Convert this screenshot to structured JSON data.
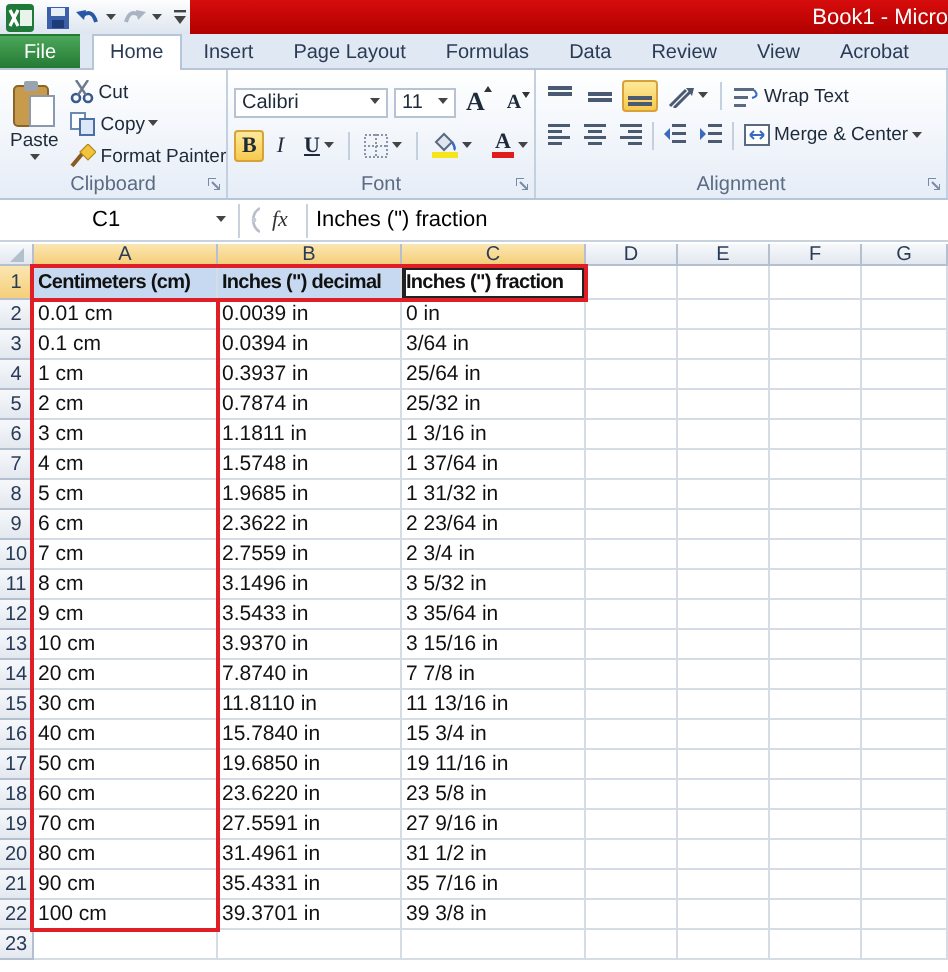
{
  "title_bar": {
    "title": "Book1 - Micro"
  },
  "tabs": [
    {
      "label": "File",
      "kind": "file",
      "selected": false
    },
    {
      "label": "Home",
      "kind": "tab",
      "selected": true
    },
    {
      "label": "Insert",
      "kind": "tab",
      "selected": false
    },
    {
      "label": "Page Layout",
      "kind": "tab",
      "selected": false
    },
    {
      "label": "Formulas",
      "kind": "tab",
      "selected": false
    },
    {
      "label": "Data",
      "kind": "tab",
      "selected": false
    },
    {
      "label": "Review",
      "kind": "tab",
      "selected": false
    },
    {
      "label": "View",
      "kind": "tab",
      "selected": false
    },
    {
      "label": "Acrobat",
      "kind": "tab",
      "selected": false
    }
  ],
  "ribbon": {
    "clipboard": {
      "label": "Clipboard",
      "paste": "Paste",
      "items": [
        {
          "kind": "cut",
          "label": "Cut"
        },
        {
          "kind": "copy",
          "label": "Copy"
        },
        {
          "kind": "painter",
          "label": "Format Painter"
        }
      ]
    },
    "font": {
      "label": "Font",
      "font_name": "Calibri",
      "font_size": "11",
      "grow": "A",
      "shrink": "A",
      "buttons": [
        {
          "kind": "bold",
          "label": "B",
          "selected": true
        },
        {
          "kind": "italic",
          "label": "I",
          "selected": false
        },
        {
          "kind": "underline",
          "label": "U",
          "selected": false
        },
        {
          "kind": "borders"
        },
        {
          "kind": "fill"
        },
        {
          "kind": "color",
          "label": "A"
        }
      ]
    },
    "alignment": {
      "label": "Alignment",
      "vertical": [
        {
          "kind": "top",
          "selected": false
        },
        {
          "kind": "middle",
          "selected": false
        },
        {
          "kind": "bottom",
          "selected": true
        }
      ],
      "horizontal": [
        {
          "kind": "left",
          "selected": false
        },
        {
          "kind": "center",
          "selected": false
        },
        {
          "kind": "right",
          "selected": false
        }
      ],
      "wrap_text": "Wrap Text",
      "merge": "Merge & Center"
    }
  },
  "formula_bar": {
    "name_box": "C1",
    "fx": "fx",
    "content": "Inches (\") fraction"
  },
  "sheet": {
    "columns": [
      {
        "label": "A",
        "selected": true,
        "framed": true
      },
      {
        "label": "B",
        "selected": true,
        "framed": false
      },
      {
        "label": "C",
        "selected": true,
        "framed": false
      },
      {
        "label": "D",
        "selected": false,
        "framed": false
      },
      {
        "label": "E",
        "selected": false,
        "framed": false
      },
      {
        "label": "F",
        "selected": false,
        "framed": false
      },
      {
        "label": "G",
        "selected": false,
        "framed": false
      }
    ],
    "rows": [
      {
        "number": "1",
        "kind": "header",
        "selected": true,
        "framed": true,
        "cells": [
          {
            "text": "Centimeters (cm)",
            "selected": true,
            "active": false
          },
          {
            "text": "Inches (\") decimal",
            "selected": true,
            "active": false
          },
          {
            "text": "Inches (\") fraction",
            "selected": true,
            "active": true
          }
        ]
      },
      {
        "number": "2",
        "kind": "data",
        "selected": false,
        "framed": false,
        "cells": [
          "0.01 cm",
          "0.0039 in",
          "0 in"
        ]
      },
      {
        "number": "3",
        "kind": "data",
        "selected": false,
        "framed": false,
        "cells": [
          "0.1 cm",
          "0.0394 in",
          "3/64 in"
        ]
      },
      {
        "number": "4",
        "kind": "data",
        "selected": false,
        "framed": false,
        "cells": [
          "1 cm",
          "0.3937 in",
          "25/64 in"
        ]
      },
      {
        "number": "5",
        "kind": "data",
        "selected": false,
        "framed": false,
        "cells": [
          "2 cm",
          "0.7874 in",
          "25/32 in"
        ]
      },
      {
        "number": "6",
        "kind": "data",
        "selected": false,
        "framed": false,
        "cells": [
          "3 cm",
          "1.1811 in",
          "1 3/16 in"
        ]
      },
      {
        "number": "7",
        "kind": "data",
        "selected": false,
        "framed": false,
        "cells": [
          "4 cm",
          "1.5748 in",
          "1 37/64 in"
        ]
      },
      {
        "number": "8",
        "kind": "data",
        "selected": false,
        "framed": false,
        "cells": [
          "5 cm",
          "1.9685 in",
          "1 31/32 in"
        ]
      },
      {
        "number": "9",
        "kind": "data",
        "selected": false,
        "framed": false,
        "cells": [
          "6 cm",
          "2.3622 in",
          "2 23/64 in"
        ]
      },
      {
        "number": "10",
        "kind": "data",
        "selected": false,
        "framed": false,
        "cells": [
          "7 cm",
          "2.7559 in",
          "2 3/4 in"
        ]
      },
      {
        "number": "11",
        "kind": "data",
        "selected": false,
        "framed": false,
        "cells": [
          "8 cm",
          "3.1496 in",
          "3 5/32 in"
        ]
      },
      {
        "number": "12",
        "kind": "data",
        "selected": false,
        "framed": false,
        "cells": [
          "9 cm",
          "3.5433 in",
          "3 35/64 in"
        ]
      },
      {
        "number": "13",
        "kind": "data",
        "selected": false,
        "framed": false,
        "cells": [
          "10 cm",
          "3.9370 in",
          "3 15/16 in"
        ]
      },
      {
        "number": "14",
        "kind": "data",
        "selected": false,
        "framed": false,
        "cells": [
          "20 cm",
          "7.8740 in",
          "7 7/8 in"
        ]
      },
      {
        "number": "15",
        "kind": "data",
        "selected": false,
        "framed": false,
        "cells": [
          "30 cm",
          "11.8110 in",
          "11 13/16 in"
        ]
      },
      {
        "number": "16",
        "kind": "data",
        "selected": false,
        "framed": false,
        "cells": [
          "40 cm",
          "15.7840 in",
          "15 3/4 in"
        ]
      },
      {
        "number": "17",
        "kind": "data",
        "selected": false,
        "framed": false,
        "cells": [
          "50 cm",
          "19.6850 in",
          "19 11/16 in"
        ]
      },
      {
        "number": "18",
        "kind": "data",
        "selected": false,
        "framed": false,
        "cells": [
          "60 cm",
          "23.6220 in",
          "23 5/8 in"
        ]
      },
      {
        "number": "19",
        "kind": "data",
        "selected": false,
        "framed": false,
        "cells": [
          "70 cm",
          "27.5591 in",
          "27 9/16 in"
        ]
      },
      {
        "number": "20",
        "kind": "data",
        "selected": false,
        "framed": false,
        "cells": [
          "80 cm",
          "31.4961 in",
          "31 1/2 in"
        ]
      },
      {
        "number": "21",
        "kind": "data",
        "selected": false,
        "framed": false,
        "cells": [
          "90 cm",
          "35.4331 in",
          "35 7/16 in"
        ]
      },
      {
        "number": "22",
        "kind": "data",
        "selected": false,
        "framed": false,
        "cells": [
          "100 cm",
          "39.3701 in",
          "39 3/8 in"
        ]
      },
      {
        "number": "23",
        "kind": "data",
        "selected": false,
        "framed": false,
        "cells": []
      }
    ]
  }
}
